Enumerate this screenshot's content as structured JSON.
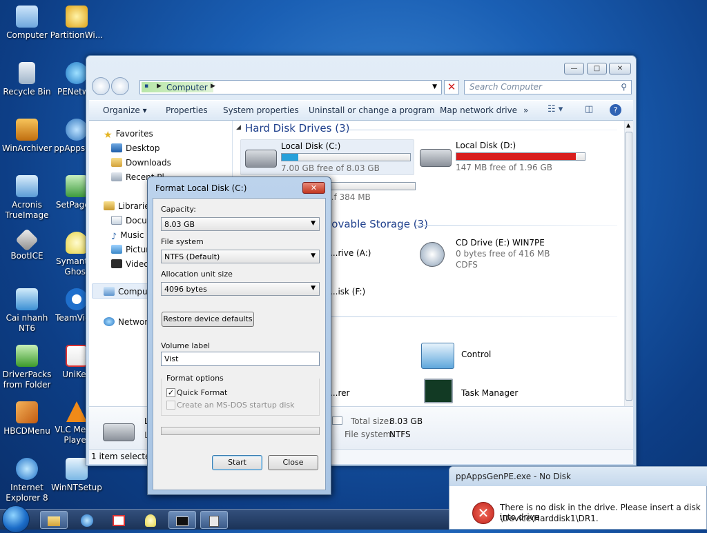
{
  "desktop": {
    "icons": [
      {
        "label": "Computer",
        "icon": "computer-icon",
        "color": "#9fc9f0"
      },
      {
        "label": "PartitionWi...",
        "icon": "partition-wizard-icon",
        "color": "#e8c23a"
      },
      {
        "label": "Recycle Bin",
        "icon": "recycle-bin-icon",
        "color": "#c7d6e6"
      },
      {
        "label": "PENetw...",
        "icon": "network-globe-icon",
        "color": "#4aa8e0"
      },
      {
        "label": "WinArchiver",
        "icon": "archiver-icon",
        "color": "#e39b2b"
      },
      {
        "label": "ppAppsG...",
        "icon": "gear-app-icon",
        "color": "#5fa3d9"
      },
      {
        "label": "Acronis TrueImage",
        "icon": "acronis-icon",
        "color": "#7db4e2"
      },
      {
        "label": "SetPage...",
        "icon": "setpage-icon",
        "color": "#60b060"
      },
      {
        "label": "BootICE",
        "icon": "bootice-icon",
        "color": "#d7d7d7"
      },
      {
        "label": "Symantec Ghost",
        "icon": "ghost-icon",
        "color": "#f3e77a"
      },
      {
        "label": "Cai nhanh NT6",
        "icon": "install-icon",
        "color": "#6cb6e8"
      },
      {
        "label": "TeamVie...",
        "icon": "teamviewer-icon",
        "color": "#2f7fd5"
      },
      {
        "label": "DriverPacks from Folder",
        "icon": "driverpacks-icon",
        "color": "#58b548"
      },
      {
        "label": "UniKey",
        "icon": "unikey-icon",
        "color": "#e04040"
      },
      {
        "label": "HBCDMenu",
        "icon": "tools-icon",
        "color": "#e8873a"
      },
      {
        "label": "VLC Media Player",
        "icon": "vlc-icon",
        "color": "#f08a18"
      },
      {
        "label": "Internet Explorer 8",
        "icon": "ie-icon",
        "color": "#3e9be0"
      },
      {
        "label": "WinNTSetup",
        "icon": "winntsetup-icon",
        "color": "#a9d3f2"
      }
    ]
  },
  "explorer": {
    "caption_buttons": {
      "minimize": "—",
      "maximize": "□",
      "close": "✕"
    },
    "address": {
      "crumb_root": "▶",
      "location": "Computer",
      "arrow": "▶"
    },
    "search_placeholder": "Search Computer",
    "toolbar": {
      "organize": "Organize ▾",
      "properties": "Properties",
      "system_properties": "System properties",
      "uninstall": "Uninstall or change a program",
      "map_drive": "Map network drive",
      "more": "»"
    },
    "nav": {
      "favorites": "Favorites",
      "desktop": "Desktop",
      "downloads": "Downloads",
      "recent": "Recent Pl...",
      "libraries": "Libraries",
      "documents": "Docum...",
      "music": "Music",
      "pictures": "Pictur...",
      "videos": "Videos",
      "computer": "Comput...",
      "network": "Network"
    },
    "groups": {
      "hard_disk": "Hard Disk Drives (3)",
      "removable": "...ovable Storage (3)"
    },
    "drives": [
      {
        "name": "Local Disk (C:)",
        "free": "7.00 GB free of 8.03 GB",
        "used_fraction": 0.13,
        "color": "#26a0da"
      },
      {
        "name": "Local Disk (D:)",
        "free": "147 MB free of 1.96 GB",
        "used_fraction": 0.93,
        "color": "#d81e1e"
      },
      {
        "free": "...f 384 MB",
        "used_fraction": 0.0
      },
      {
        "name": "...rive (A:)"
      },
      {
        "name": "CD Drive (E:) WIN7PE",
        "free": "0 bytes free of 416 MB",
        "fs": "CDFS"
      },
      {
        "name": "...isk (F:)"
      }
    ],
    "other_items": {
      "control": "Control",
      "task_manager": "Task Manager",
      "explorer_partial": "...rer"
    },
    "details": {
      "total_size_label": "Total size:",
      "total_size": "8.03 GB",
      "fs_label": "File system:",
      "fs": "NTFS",
      "name_partial": "L...",
      "sub_partial": "L..."
    },
    "status": "1 item selected"
  },
  "format_dialog": {
    "title": "Format Local Disk (C:)",
    "close": "✕",
    "capacity_label": "Capacity:",
    "capacity": "8.03 GB",
    "fs_label": "File system",
    "fs": "NTFS (Default)",
    "alloc_label": "Allocation unit size",
    "alloc": "4096 bytes",
    "restore": "Restore device defaults",
    "volume_label": "Volume label",
    "volume_value": "Vist",
    "options_label": "Format options",
    "quick_format": "Quick Format",
    "quick_format_checked": true,
    "msdos": "Create an MS-DOS startup disk",
    "start": "Start",
    "close_btn": "Close"
  },
  "error_dialog": {
    "title": "ppAppsGenPE.exe - No Disk",
    "line1": "There is no disk in the drive. Please insert a disk into drive",
    "line2": "\\Device\\Harddisk1\\DR1."
  },
  "taskbar": {
    "buttons": [
      "folder-icon",
      "ie-icon",
      "unikey-icon",
      "ghost-icon",
      "cmd-icon",
      "calc-icon"
    ]
  }
}
